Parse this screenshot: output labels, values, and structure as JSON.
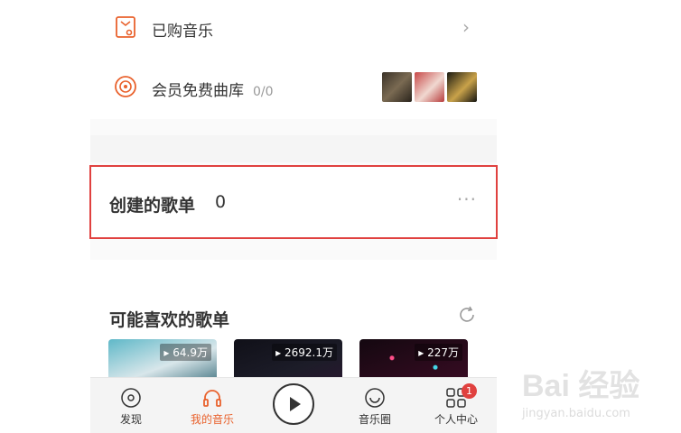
{
  "purchased": {
    "label": "已购音乐"
  },
  "vip_library": {
    "label": "会员免费曲库",
    "count": "0/0"
  },
  "created_playlists": {
    "title": "创建的歌单",
    "count": "0",
    "more": "···"
  },
  "recommended": {
    "title": "可能喜欢的歌单",
    "cards": [
      {
        "plays": "64.9万"
      },
      {
        "plays": "2692.1万"
      },
      {
        "plays": "227万"
      }
    ]
  },
  "tabbar": {
    "discover": "发现",
    "my_music": "我的音乐",
    "music_circle": "音乐圈",
    "personal_center": "个人中心",
    "notification_badge": "1"
  },
  "watermark": {
    "brand": "Bai 经验",
    "url": "jingyan.baidu.com"
  },
  "colors": {
    "accent": "#e9622d",
    "highlight_border": "#e0413f"
  }
}
